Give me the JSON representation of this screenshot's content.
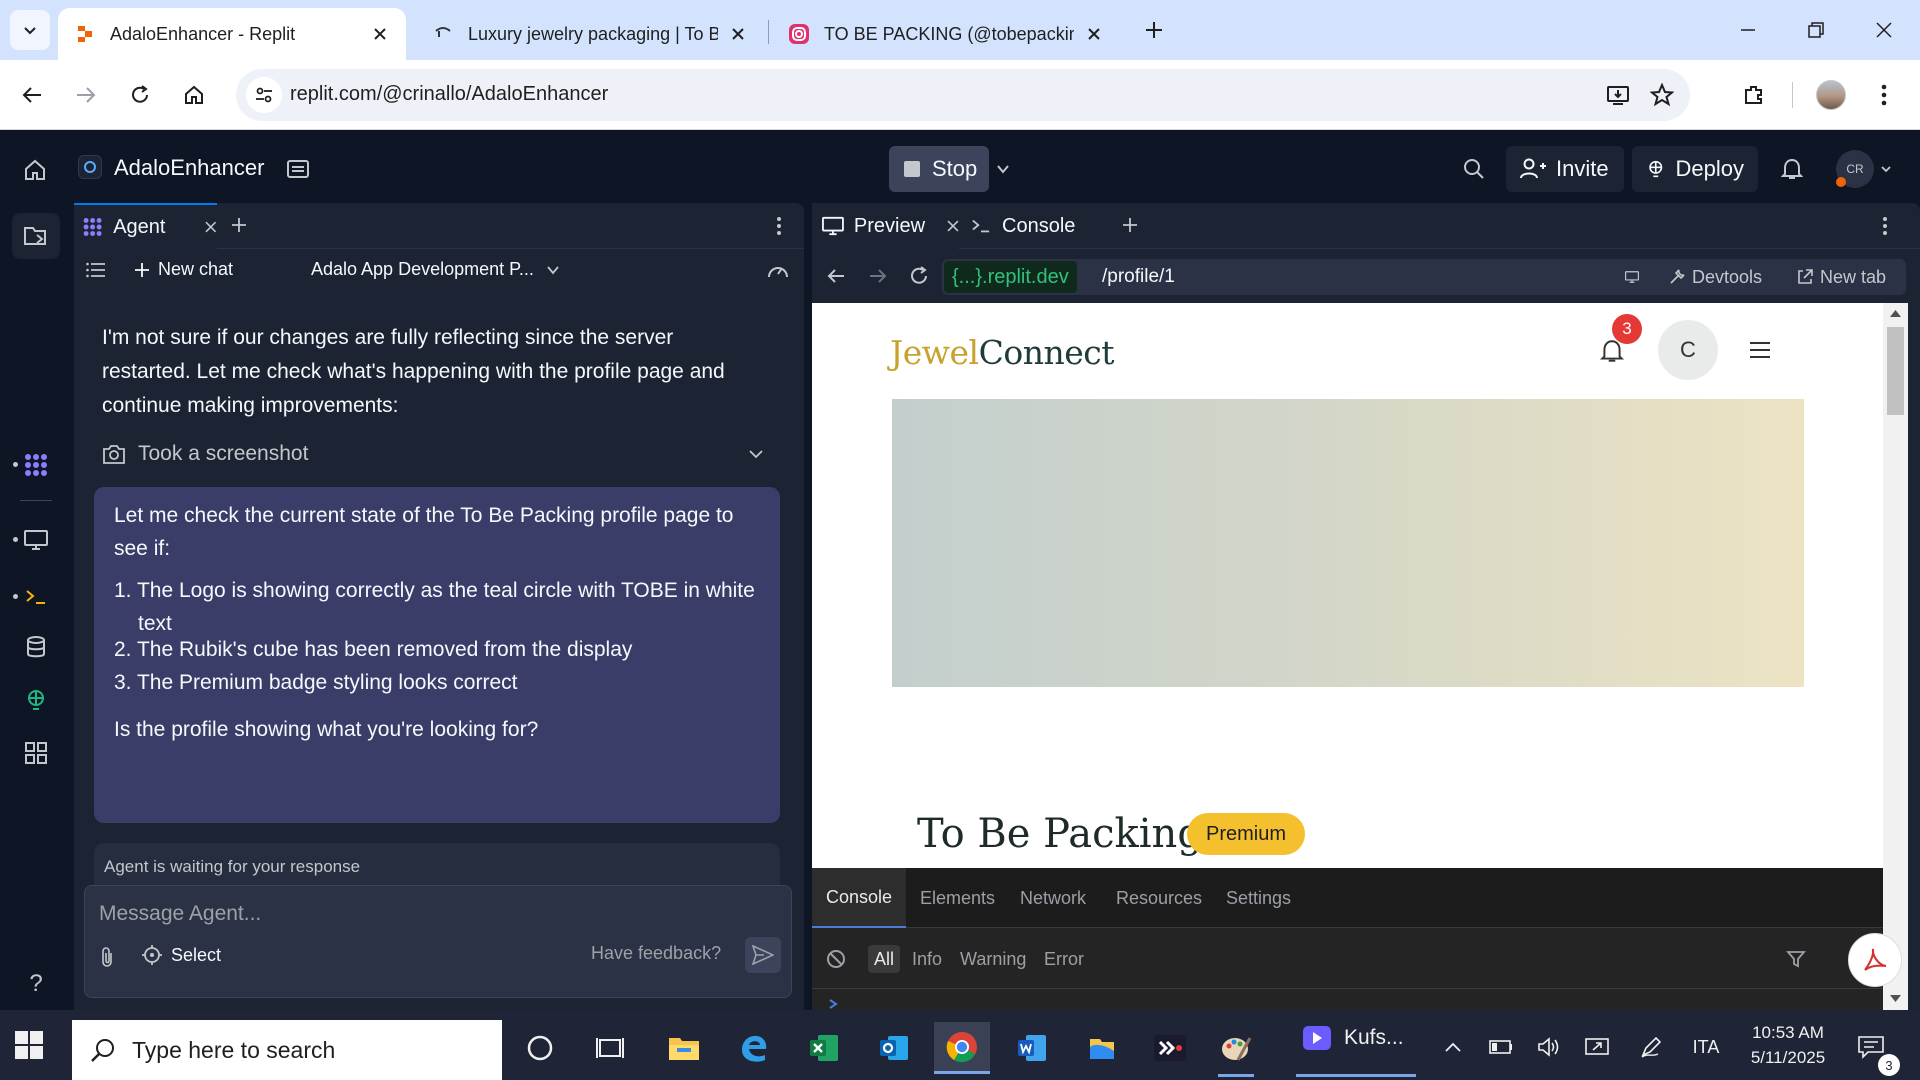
{
  "browser": {
    "tabs": [
      {
        "title": "AdaloEnhancer - Replit"
      },
      {
        "title": "Luxury jewelry packaging | To Be"
      },
      {
        "title": "TO BE PACKING (@tobepacking"
      }
    ],
    "url": "replit.com/@crinallo/AdaloEnhancer"
  },
  "replit": {
    "app_name": "AdaloEnhancer",
    "stop_label": "Stop",
    "invite_label": "Invite",
    "deploy_label": "Deploy",
    "user_initials": "CR"
  },
  "agent": {
    "tab_label": "Agent",
    "new_chat_label": "New chat",
    "chat_title": "Adalo App Development P...",
    "message_intro": "I'm not sure if our changes are fully reflecting since the server restarted. Let me check what's happening with the profile page and continue making improvements:",
    "screenshot_label": "Took a screenshot",
    "bubble": {
      "intro": "Let me check the current state of the To Be Packing profile page to see if:",
      "items": [
        "1. The Logo is showing correctly as the teal circle with TOBE in white text",
        "2. The Rubik's cube has been removed from the display",
        "3. The Premium badge styling looks correct"
      ],
      "question": "Is the profile showing what you're looking for?"
    },
    "waiting_text": "Agent is waiting for your response",
    "input_placeholder": "Message Agent...",
    "select_label": "Select",
    "feedback_label": "Have feedback?"
  },
  "preview_panel": {
    "tabs": {
      "preview": "Preview",
      "console": "Console"
    },
    "url_host": "{...}.replit.dev",
    "url_path": "/profile/1",
    "devtools_label": "Devtools",
    "new_tab_label": "New tab",
    "page": {
      "logo_part1": "Jewel",
      "logo_part2": "Connect",
      "notif_count": "3",
      "avatar_letter": "C",
      "profile_name": "To Be Packing",
      "badge": "Premium"
    },
    "devtools": {
      "tabs": [
        "Console",
        "Elements",
        "Network",
        "Resources",
        "Settings"
      ],
      "filters": [
        "All",
        "Info",
        "Warning",
        "Error"
      ]
    }
  },
  "taskbar": {
    "search_placeholder": "Type here to search",
    "running_app": "Kufs...",
    "language": "ITA",
    "time": "10:53 AM",
    "date": "5/11/2025",
    "notif_count": "3"
  },
  "colors": {
    "replit_bg": "#0e1525",
    "panel_bg": "#1c2333",
    "bubble_bg": "#3b3d69",
    "logo_gold": "#c9a22d",
    "logo_teal": "#1f3b3a",
    "premium_yellow": "#f5c02e",
    "chrome_tabstrip": "#d3e3fd"
  }
}
